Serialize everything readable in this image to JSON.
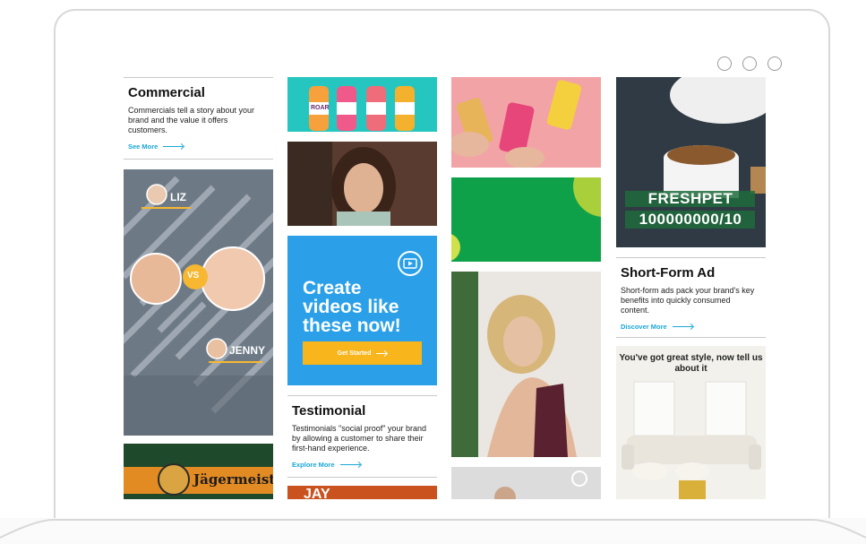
{
  "window": {
    "controls": [
      "dot",
      "dot",
      "dot"
    ]
  },
  "commercial": {
    "title": "Commercial",
    "description": "Commercials tell a story about your brand and the value it offers customers.",
    "link": "See More"
  },
  "comparison_video": {
    "left_name": "LIZ",
    "right_name": "JENNY",
    "badge": "VS"
  },
  "jagermeister": {
    "logo_text": "Jägermeister"
  },
  "roar": {
    "brand": "ROAR"
  },
  "cta": {
    "headline": "Create videos like these now!",
    "button": "Get Started",
    "icon": "video-icon"
  },
  "testimonial": {
    "title": "Testimonial",
    "description": "Testimonials \"social proof\" your brand by allowing a customer to share their first-hand experience.",
    "link": "Explore More"
  },
  "partial_tile": {
    "text": "JAY"
  },
  "freshpet": {
    "line1": "FRESHPET",
    "line2": "100000000/10"
  },
  "short_form": {
    "title": "Short-Form Ad",
    "description": "Short-form ads pack your brand's key benefits into quickly consumed content.",
    "link": "Discover More"
  },
  "style_ad": {
    "text": "You've got great style, now tell us about it"
  },
  "colors": {
    "cta_blue": "#2ba0e8",
    "button_yellow": "#f8b51c",
    "link_blue": "#1aa7d6",
    "green": "#0fa14a"
  }
}
